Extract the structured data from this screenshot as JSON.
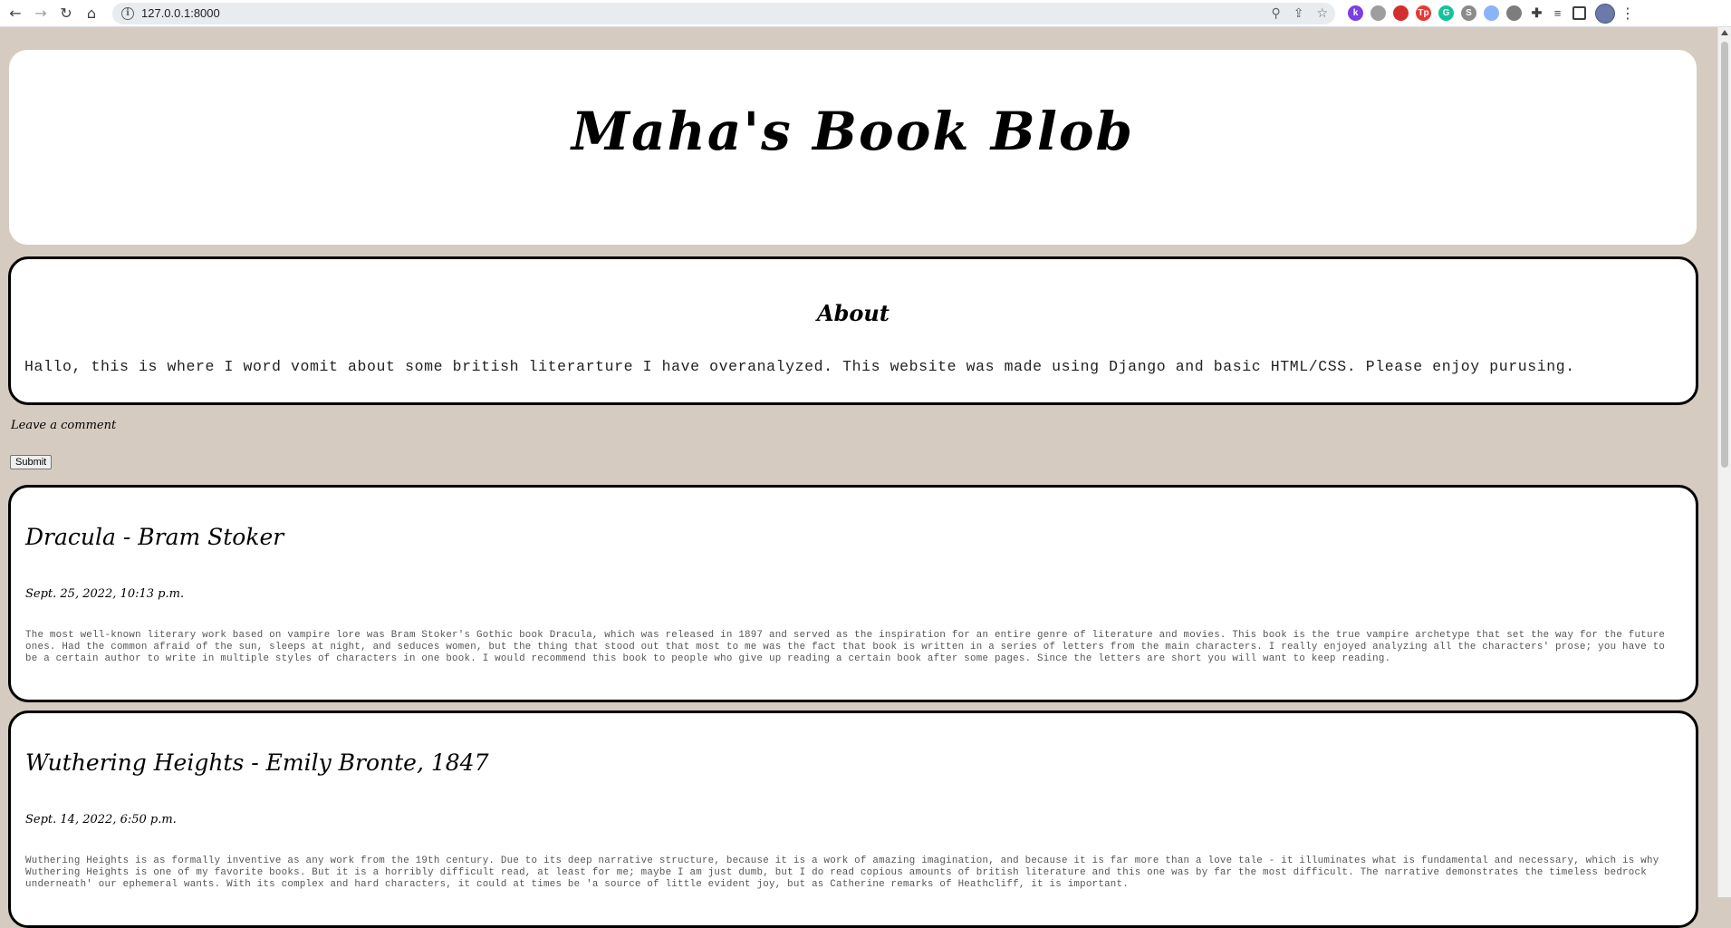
{
  "browser": {
    "url": "127.0.0.1:8000",
    "extensions": [
      {
        "name": "k-extension-icon",
        "letter": "k",
        "color": "#7b3fe4"
      },
      {
        "name": "reader-extension-icon",
        "letter": "",
        "color": "#9e9e9e"
      },
      {
        "name": "adblock-extension-icon",
        "letter": "",
        "color": "#d32f2f"
      },
      {
        "name": "tp-extension-icon",
        "letter": "Tp",
        "color": "#e53935"
      },
      {
        "name": "grammarly-extension-icon",
        "letter": "G",
        "color": "#15c39a"
      },
      {
        "name": "s-extension-icon",
        "letter": "S",
        "color": "#8a8a8a"
      },
      {
        "name": "globe-extension-icon",
        "letter": "",
        "color": "#8ab4f8"
      },
      {
        "name": "image-extension-icon",
        "letter": "",
        "color": "#7d7d7d"
      }
    ]
  },
  "site": {
    "title": "Maha's Book Blob"
  },
  "about": {
    "heading": "About",
    "text": "Hallo, this is where I word vomit about some british literarture I have overanalyzed. This website was made using Django and basic HTML/CSS. Please enjoy purusing."
  },
  "comment": {
    "label": "Leave a comment",
    "submit_label": "Submit"
  },
  "posts": [
    {
      "title": "Dracula - Bram Stoker",
      "date": "Sept. 25, 2022, 10:13 p.m.",
      "body": "The most well-known literary work based on vampire lore was Bram Stoker's Gothic book Dracula, which was released in 1897 and served as the inspiration for an entire genre of literature and movies. This book is the true vampire archetype that set the way for the future ones. Had the common afraid of the sun, sleeps at night, and seduces women, but the thing that stood out that most to me was the fact that book is written in a series of letters from the main characters. I really enjoyed analyzing all the characters' prose; you have to be a certain author to write in multiple styles of characters in one book. I would recommend this book to people who give up reading a certain book after some pages. Since the letters are short you will want to keep reading."
    },
    {
      "title": "Wuthering Heights - Emily Bronte, 1847",
      "date": "Sept. 14, 2022, 6:50 p.m.",
      "body": "Wuthering Heights is as formally inventive as any work from the 19th century. Due to its deep narrative structure, because it is a work of amazing imagination, and because it is far more than a love tale - it illuminates what is fundamental and necessary, which is why Wuthering Heights is one of my favorite books. But it is a horribly difficult read, at least for me; maybe I am just dumb, but I do read copious amounts of british literature and this one was by far the most difficult. The narrative demonstrates the timeless bedrock underneath' our ephemeral wants. With its complex and hard characters, it could at times be 'a source of little evident joy, but as Catherine remarks of Heathcliff, it is important."
    }
  ]
}
